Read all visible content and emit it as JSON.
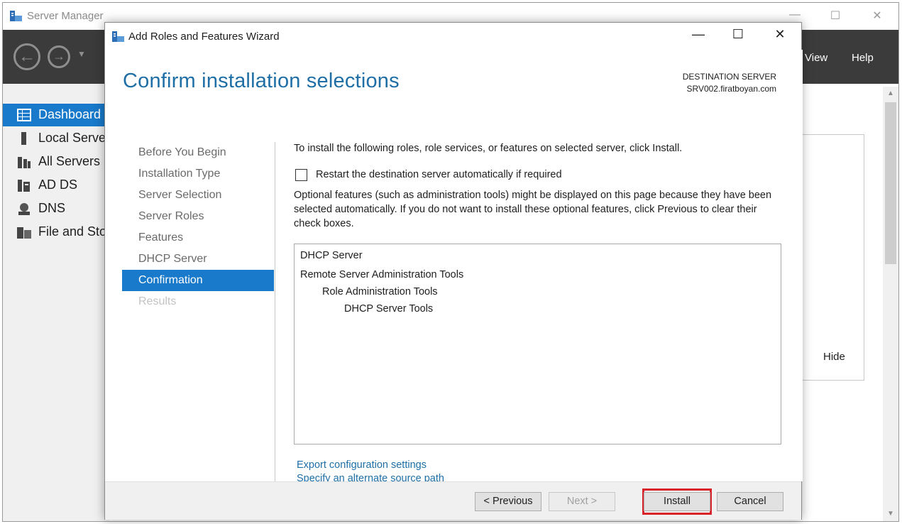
{
  "server_manager": {
    "title": "Server Manager",
    "controls": {
      "minimize": "—",
      "maximize": "☐",
      "close": "✕"
    },
    "menu": {
      "view": "View",
      "help": "Help"
    },
    "sidebar": {
      "items": [
        {
          "label": "Dashboard",
          "icon": "dashboard-icon",
          "active": true
        },
        {
          "label": "Local Server",
          "icon": "local-server-icon"
        },
        {
          "label": "All Servers",
          "icon": "all-servers-icon"
        },
        {
          "label": "AD DS",
          "icon": "ad-ds-icon"
        },
        {
          "label": "DNS",
          "icon": "dns-icon"
        },
        {
          "label": "File and Stor",
          "icon": "file-storage-icon"
        }
      ]
    },
    "hide_label": "Hide"
  },
  "wizard": {
    "title": "Add Roles and Features Wizard",
    "controls": {
      "minimize": "—",
      "maximize": "☐",
      "close": "✕"
    },
    "heading": "Confirm installation selections",
    "destination": {
      "label": "DESTINATION SERVER",
      "server": "SRV002.firatboyan.com"
    },
    "steps": [
      {
        "label": "Before You Begin"
      },
      {
        "label": "Installation Type"
      },
      {
        "label": "Server Selection"
      },
      {
        "label": "Server Roles"
      },
      {
        "label": "Features"
      },
      {
        "label": "DHCP Server"
      },
      {
        "label": "Confirmation",
        "active": true
      },
      {
        "label": "Results",
        "disabled": true
      }
    ],
    "intro": "To install the following roles, role services, or features on selected server, click Install.",
    "restart_checkbox": {
      "label": "Restart the destination server automatically if required",
      "checked": false
    },
    "note": "Optional features (such as administration tools) might be displayed on this page because they have been selected automatically. If you do not want to install these optional features, click Previous to clear their check boxes.",
    "selections": [
      {
        "label": "DHCP Server",
        "level": 0
      },
      {
        "label": "Remote Server Administration Tools",
        "level": 0
      },
      {
        "label": "Role Administration Tools",
        "level": 1
      },
      {
        "label": "DHCP Server Tools",
        "level": 2
      }
    ],
    "links": {
      "export": "Export configuration settings",
      "alternate_source": "Specify an alternate source path"
    },
    "buttons": {
      "previous": "< Previous",
      "next": "Next >",
      "install": "Install",
      "cancel": "Cancel"
    },
    "colors": {
      "accent": "#1979ca",
      "heading": "#1f6fa6",
      "highlight": "#d8232a"
    }
  }
}
